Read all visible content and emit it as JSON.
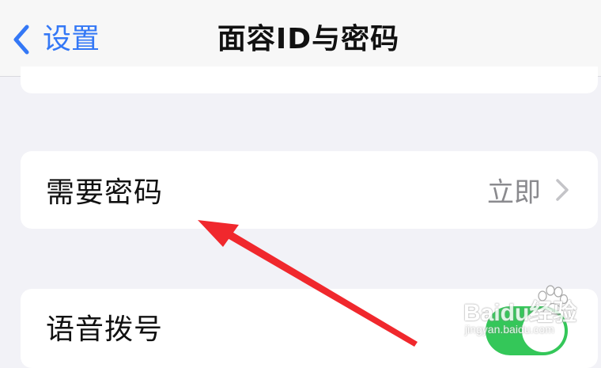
{
  "navbar": {
    "back_label": "设置",
    "title": "面容ID与密码"
  },
  "rows": [
    {
      "label": "需要密码",
      "value": "立即"
    },
    {
      "label": "语音拨号",
      "toggle_on": true
    }
  ],
  "watermark": {
    "brand": "Baidu经验",
    "url": "jingyan.baidu.com"
  },
  "colors": {
    "accent": "#3478f6",
    "toggle_on": "#34c759",
    "annotation_arrow": "#f0282d",
    "background": "#f2f2f7"
  }
}
